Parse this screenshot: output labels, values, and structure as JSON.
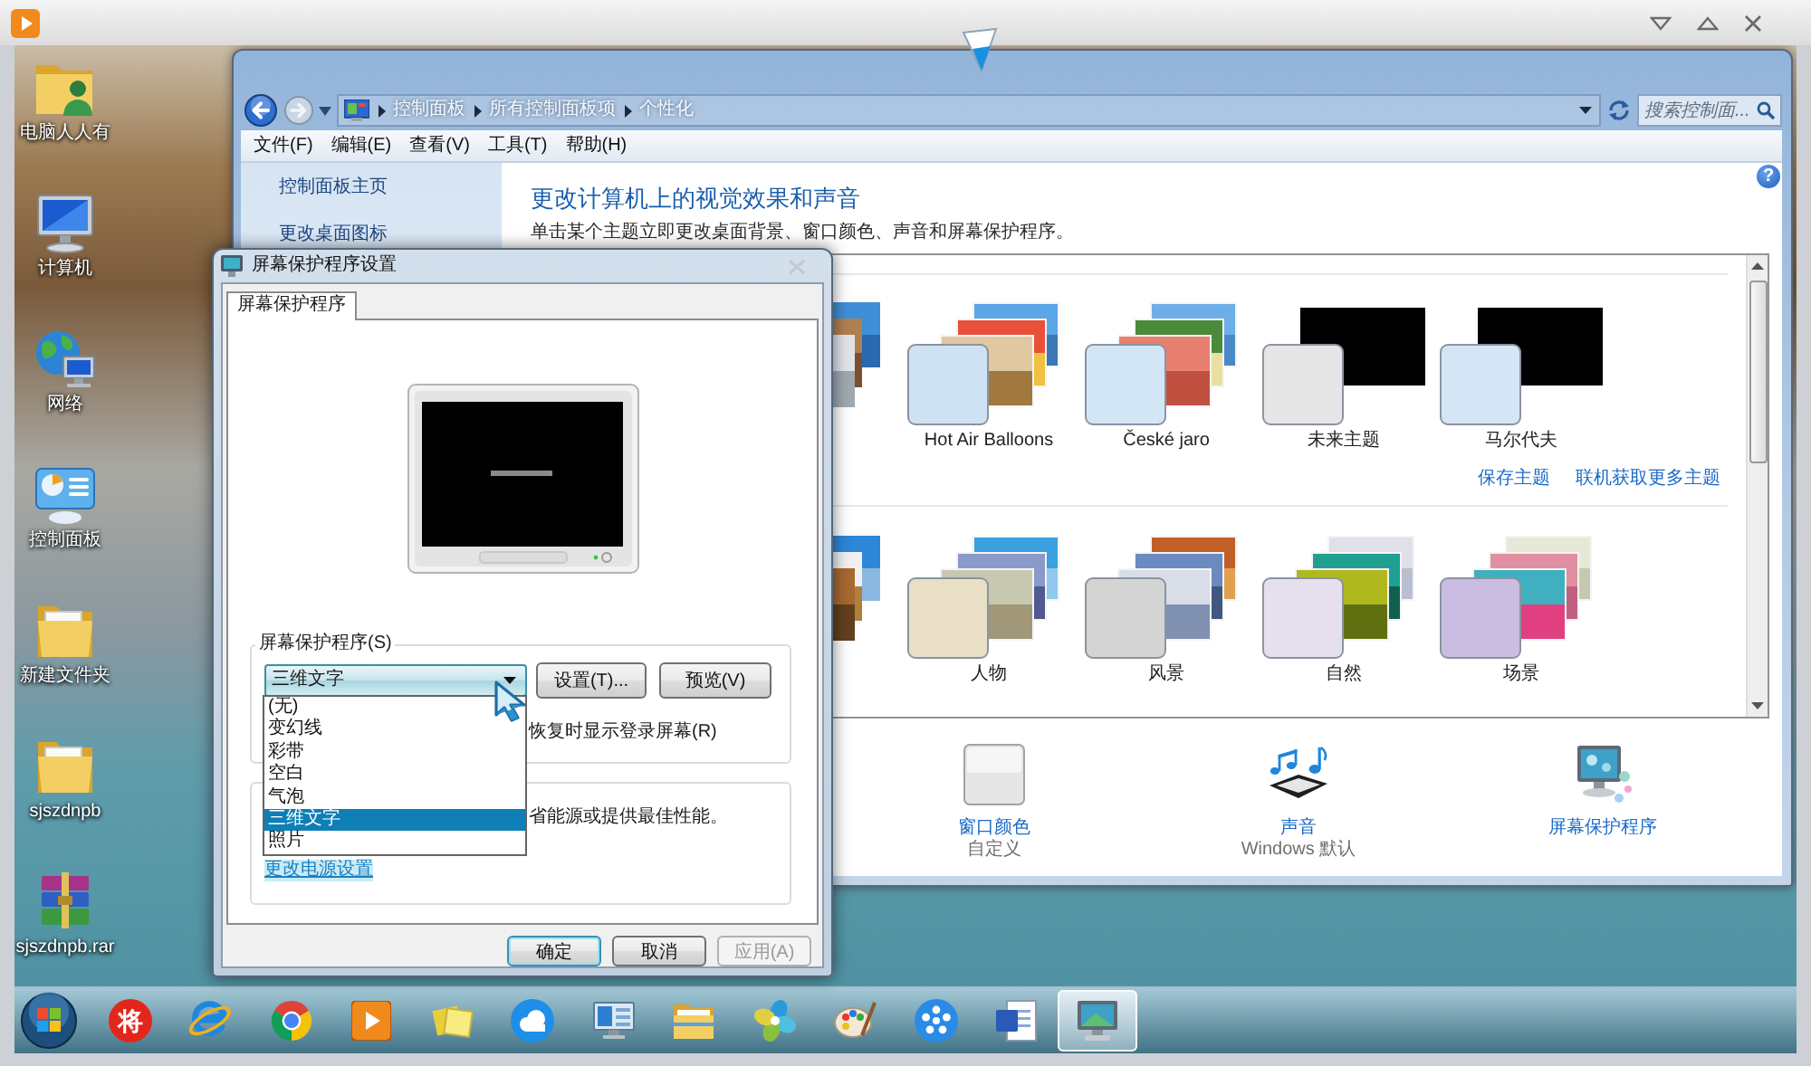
{
  "desktop": {
    "icons": [
      {
        "label": "电脑人人有",
        "kind": "user-folder"
      },
      {
        "label": "计算机",
        "kind": "computer"
      },
      {
        "label": "网络",
        "kind": "network"
      },
      {
        "label": "控制面板",
        "kind": "control-panel"
      },
      {
        "label": "新建文件夹",
        "kind": "folder"
      },
      {
        "label": "sjszdnpb",
        "kind": "folder"
      },
      {
        "label": "sjszdnpb.rar",
        "kind": "archive"
      }
    ]
  },
  "control_panel": {
    "breadcrumbs": [
      "控制面板",
      "所有控制面板项",
      "个性化"
    ],
    "search": {
      "placeholder": "搜索控制面..."
    },
    "help": "?",
    "menu": [
      "文件(F)",
      "编辑(E)",
      "查看(V)",
      "工具(T)",
      "帮助(H)"
    ],
    "nav": [
      "控制面板主页",
      "更改桌面图标"
    ],
    "title": "更改计算机上的视觉效果和声音",
    "description": "单击某个主题立即更改桌面背景、窗口颜色、声音和屏幕保护程序。",
    "theme_groups": [
      {
        "themes": [
          {
            "kind": "partial"
          },
          {
            "kind": "photos",
            "label": "Hot Air Balloons",
            "color": "#cfe2f4"
          },
          {
            "kind": "photos",
            "label": "České jaro",
            "color": "#d2e6f6"
          },
          {
            "kind": "blank",
            "label": "未来主题",
            "color": "#e6e6e6"
          },
          {
            "kind": "blank",
            "label": "马尔代夫",
            "color": "#d4e6f6"
          }
        ],
        "links": [
          "保存主题",
          "联机获取更多主题"
        ]
      },
      {
        "themes": [
          {
            "kind": "partial"
          },
          {
            "kind": "photos",
            "label": "人物",
            "color": "#e8dfc6"
          },
          {
            "kind": "photos",
            "label": "风景",
            "color": "#d4d4d4"
          },
          {
            "kind": "photos",
            "label": "自然",
            "color": "#e6e0ee"
          },
          {
            "kind": "photos",
            "label": "场景",
            "color": "#cbbde2"
          }
        ]
      }
    ],
    "settings": [
      {
        "kind": "swatch",
        "label": "窗口颜色",
        "value": "自定义"
      },
      {
        "kind": "music",
        "label": "声音",
        "value": "Windows 默认"
      },
      {
        "kind": "monitor",
        "label": "屏幕保护程序"
      }
    ]
  },
  "dialog": {
    "title": "屏幕保护程序设置",
    "tabs": [
      {
        "label": "屏幕保护程序",
        "selected": true
      }
    ],
    "screensaver": {
      "legend": "屏幕保护程序(S)",
      "value": "三维文字",
      "expanded": true,
      "options": [
        {
          "label": "(无)",
          "selected": false
        },
        {
          "label": "变幻线",
          "selected": false
        },
        {
          "label": "彩带",
          "selected": false
        },
        {
          "label": "空白",
          "selected": false
        },
        {
          "label": "气泡",
          "selected": false
        },
        {
          "label": "三维文字",
          "selected": true
        },
        {
          "label": "照片",
          "selected": false
        }
      ],
      "buttons": [
        "设置(T)...",
        "预览(V)"
      ],
      "resume_label": "恢复时显示登录屏幕(R)"
    },
    "power": {
      "text": "省能源或提供最佳性能。",
      "link": "更改电源设置"
    },
    "buttons": [
      {
        "label": "确定",
        "default": true,
        "disabled": false
      },
      {
        "label": "取消",
        "default": false,
        "disabled": false
      },
      {
        "label": "应用(A)",
        "default": false,
        "disabled": true
      }
    ]
  },
  "taskbar": {
    "items": [
      {
        "kind": "glyph",
        "glyph": "将",
        "selected": false
      },
      {
        "kind": "ring-orbit",
        "selected": false
      },
      {
        "kind": "segmented-circle",
        "selected": false
      },
      {
        "kind": "play",
        "selected": false
      },
      {
        "kind": "notes",
        "selected": false
      },
      {
        "kind": "cloud",
        "selected": false
      },
      {
        "kind": "remote-monitor",
        "selected": false
      },
      {
        "kind": "folder",
        "selected": false
      },
      {
        "kind": "pinwheel",
        "selected": false
      },
      {
        "kind": "palette",
        "selected": false
      },
      {
        "kind": "reel",
        "selected": false
      },
      {
        "kind": "document",
        "selected": false
      },
      {
        "kind": "monitor",
        "selected": true
      }
    ]
  }
}
